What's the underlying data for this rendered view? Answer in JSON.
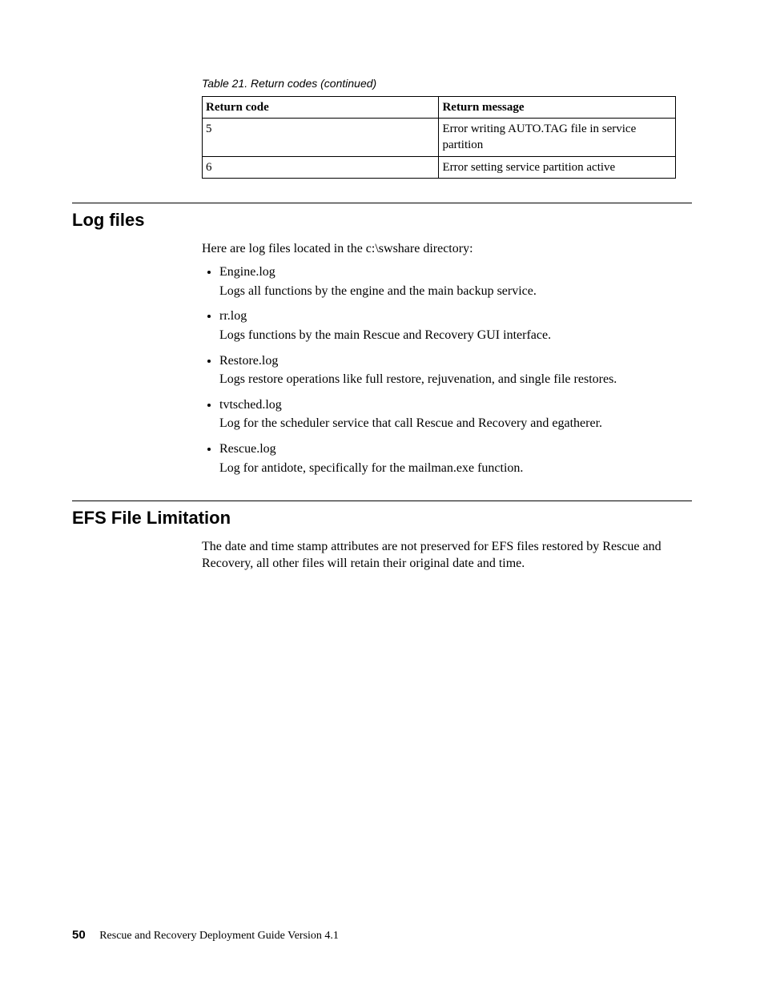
{
  "table": {
    "caption": "Table 21. Return codes  (continued)",
    "header": {
      "col1": "Return code",
      "col2": "Return message"
    },
    "rows": [
      {
        "code": "5",
        "message": "Error writing AUTO.TAG file in service partition"
      },
      {
        "code": "6",
        "message": "Error setting service partition active"
      }
    ]
  },
  "sections": {
    "log_files": {
      "title": "Log files",
      "intro": "Here are log files located in the c:\\swshare directory:",
      "items": [
        {
          "name": "Engine.log",
          "desc": "Logs all functions by the engine and the main backup service."
        },
        {
          "name": "rr.log",
          "desc": "Logs functions by the main Rescue and Recovery GUI interface."
        },
        {
          "name": "Restore.log",
          "desc": "Logs restore operations like full restore, rejuvenation, and single file restores."
        },
        {
          "name": "tvtsched.log",
          "desc": "Log for the scheduler service that call Rescue and Recovery and egatherer."
        },
        {
          "name": "Rescue.log",
          "desc": "Log for antidote, specifically for the mailman.exe function."
        }
      ]
    },
    "efs": {
      "title": "EFS File Limitation",
      "body": "The date and time stamp attributes are not preserved for EFS files restored by Rescue and Recovery, all other files will retain their original date and time."
    }
  },
  "footer": {
    "pageno": "50",
    "title": "Rescue and Recovery Deployment Guide Version 4.1"
  }
}
